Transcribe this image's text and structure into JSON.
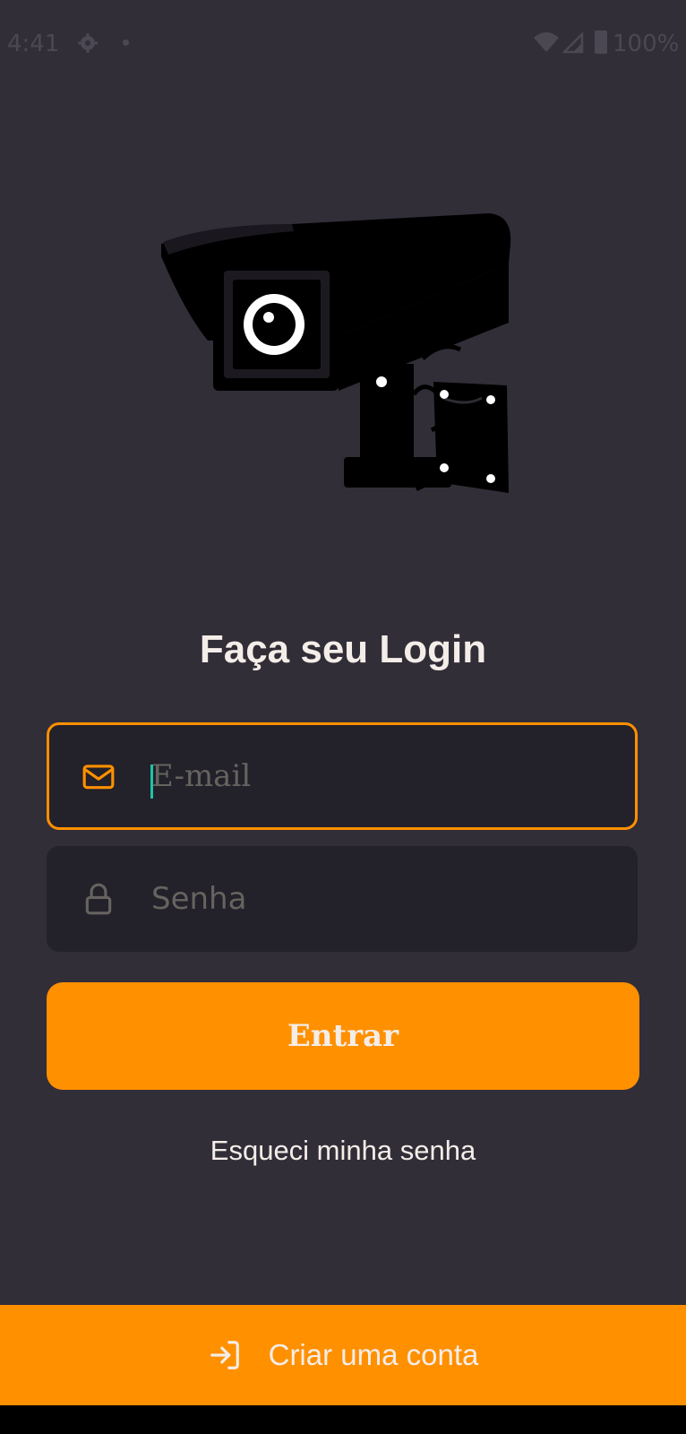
{
  "status_bar": {
    "time": "4:41",
    "battery": "100%"
  },
  "login": {
    "title": "Faça seu Login",
    "email_placeholder": "E-mail",
    "password_placeholder": "Senha",
    "submit_label": "Entrar",
    "forgot_password": "Esqueci minha senha"
  },
  "footer": {
    "create_account_label": "Criar uma conta"
  },
  "icons": {
    "email": "mail-icon",
    "password": "lock-icon",
    "create_account": "log-in-icon",
    "logo": "security-camera-logo"
  },
  "colors": {
    "background": "#312e38",
    "input_background": "#232129",
    "accent": "#ff9000",
    "text": "#f4ede8",
    "placeholder": "#666360"
  }
}
